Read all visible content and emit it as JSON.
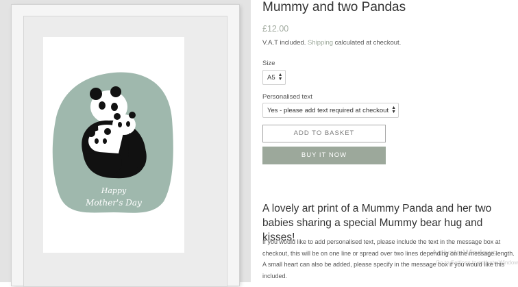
{
  "product": {
    "title": "Mummy and two Pandas",
    "price": "£12.00",
    "tax_note_prefix": "V.A.T included. ",
    "tax_note_link": "Shipping",
    "tax_note_suffix": " calculated at checkout."
  },
  "options": {
    "size_label": "Size",
    "size_value": "A5",
    "text_label": "Personalised text",
    "text_value": "Yes - please add text required at checkout"
  },
  "buttons": {
    "add_to_basket": "ADD TO BASKET",
    "buy_it_now": "BUY IT NOW"
  },
  "description": {
    "headline": "A lovely art print of a Mummy Panda and her two babies sharing a special Mummy bear hug and kisses!",
    "body": "If you would like to add personalised text, please include the text in the message box at checkout, this will be on one line or spread over two lines depending on the message length.  A small heart can also be added, please specify in the message box if you would like this included."
  },
  "artwork": {
    "caption_line1": "Happy",
    "caption_line2": "Mother's Day"
  },
  "watermark": {
    "title": "Activate Windows",
    "subtitle": "Go to Settings to activate Windows."
  },
  "colors": {
    "accent": "#9ca89b",
    "link": "#9eaa9c",
    "price": "#a3aca1",
    "artwork_bg": "#9fb8ad"
  }
}
